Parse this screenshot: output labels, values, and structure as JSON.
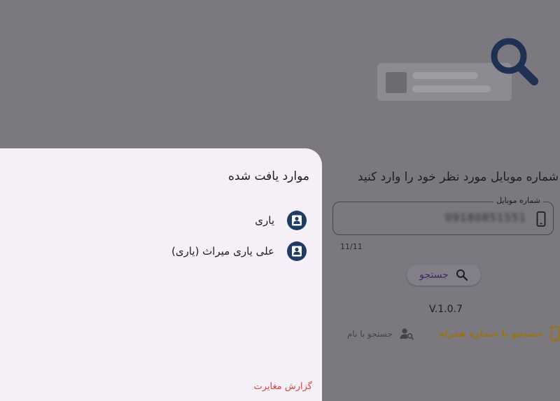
{
  "background": {
    "prompt": "شماره موبایل مورد نظر خود را وارد کنید",
    "phone_field": {
      "label": "شماره موبایل",
      "value": "09180851551",
      "counter": "11/11"
    },
    "search_button": {
      "label": "جستجو"
    },
    "version": "V.1.0.7",
    "bottom_nav": [
      {
        "label": "جستجو با شماره همراه",
        "icon": "phone-icon",
        "color": "#9a7212"
      },
      {
        "label": "جستجو با نام",
        "icon": "person-search-icon",
        "color": "#44424a"
      }
    ]
  },
  "sheet": {
    "title": "موارد یافت شده",
    "results": [
      {
        "name": "یاری",
        "icon": "user-avatar-icon"
      },
      {
        "name": "علی یاری میراث (یاری)",
        "icon": "user-avatar-icon"
      }
    ],
    "report_link": "گزارش مغایرت"
  },
  "colors": {
    "overlay": "#7b797f",
    "sheet_bg": "#f5f0f7",
    "avatar": "#1e3c64",
    "accent_red": "#d8453d",
    "accent_gold": "#9a7212"
  }
}
